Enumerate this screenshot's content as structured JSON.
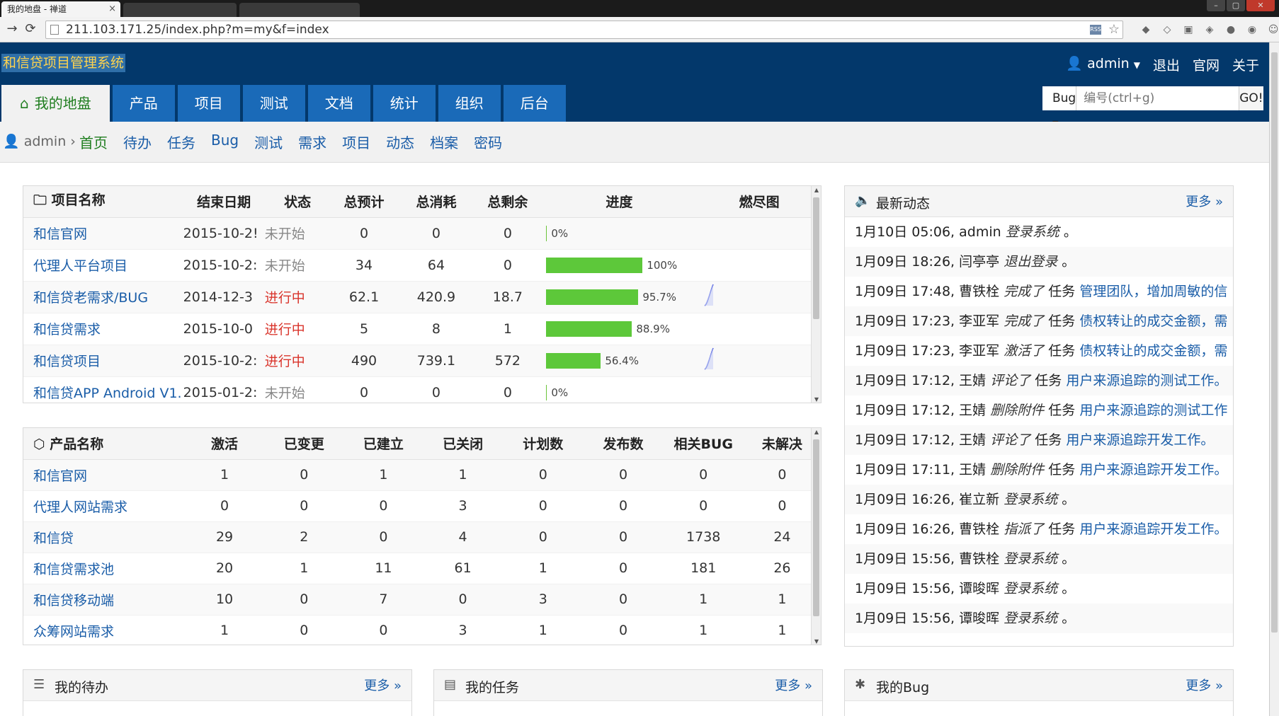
{
  "browser": {
    "tab_title": "我的地盘 - 禅道",
    "tab_close": "×",
    "url": "211.103.171.25/index.php?m=my&f=index",
    "win_controls": [
      "–",
      "▢",
      "✕"
    ]
  },
  "header": {
    "app_title": "和信贷项目管理系统",
    "user": "admin",
    "links": [
      "退出",
      "官网",
      "关于"
    ],
    "nav": [
      "我的地盘",
      "产品",
      "项目",
      "测试",
      "文档",
      "统计",
      "组织",
      "后台"
    ],
    "search": {
      "type": "Bug",
      "placeholder": "编号(ctrl+g)",
      "go": "GO!"
    }
  },
  "subnav": {
    "user": "admin",
    "items": [
      "首页",
      "待办",
      "任务",
      "Bug",
      "测试",
      "需求",
      "项目",
      "动态",
      "档案",
      "密码"
    ]
  },
  "projects": {
    "headers": [
      "项目名称",
      "结束日期",
      "状态",
      "总预计",
      "总消耗",
      "总剩余",
      "进度",
      "燃尽图"
    ],
    "rows": [
      {
        "name": "和信官网",
        "end": "2015-10-2!",
        "status": "未开始",
        "est": "0",
        "cons": "0",
        "left": "0",
        "pct": "0%",
        "progress": 0,
        "burn": false
      },
      {
        "name": "代理人平台项目",
        "end": "2015-10-2:",
        "status": "未开始",
        "est": "34",
        "cons": "64",
        "left": "0",
        "pct": "100%",
        "progress": 100,
        "burn": false
      },
      {
        "name": "和信贷老需求/BUG",
        "end": "2014-12-3",
        "status": "进行中",
        "est": "62.1",
        "cons": "420.9",
        "left": "18.7",
        "pct": "95.7%",
        "progress": 95.7,
        "burn": true
      },
      {
        "name": "和信贷需求",
        "end": "2015-10-0",
        "status": "进行中",
        "est": "5",
        "cons": "8",
        "left": "1",
        "pct": "88.9%",
        "progress": 88.9,
        "burn": false
      },
      {
        "name": "和信贷项目",
        "end": "2015-10-2:",
        "status": "进行中",
        "est": "490",
        "cons": "739.1",
        "left": "572",
        "pct": "56.4%",
        "progress": 56.4,
        "burn": true
      },
      {
        "name": "和信贷APP Android V1.",
        "end": "2015-01-2:",
        "status": "未开始",
        "est": "0",
        "cons": "0",
        "left": "0",
        "pct": "0%",
        "progress": 0,
        "burn": false
      }
    ]
  },
  "products": {
    "headers": [
      "产品名称",
      "激活",
      "已变更",
      "已建立",
      "已关闭",
      "计划数",
      "发布数",
      "相关BUG",
      "未解决"
    ],
    "rows": [
      [
        "和信官网",
        "1",
        "0",
        "1",
        "1",
        "0",
        "0",
        "0",
        "0"
      ],
      [
        "代理人网站需求",
        "0",
        "0",
        "0",
        "3",
        "0",
        "0",
        "0",
        "0"
      ],
      [
        "和信贷",
        "29",
        "2",
        "0",
        "4",
        "0",
        "0",
        "1738",
        "24"
      ],
      [
        "和信贷需求池",
        "20",
        "1",
        "11",
        "61",
        "1",
        "0",
        "181",
        "26"
      ],
      [
        "和信贷移动端",
        "10",
        "0",
        "7",
        "0",
        "3",
        "0",
        "1",
        "1"
      ],
      [
        "众筹网站需求",
        "1",
        "0",
        "0",
        "3",
        "1",
        "0",
        "1",
        "1"
      ]
    ]
  },
  "dynamics": {
    "title": "最新动态",
    "more": "更多 »",
    "rows": [
      {
        "time": "1月10日 05:06,",
        "user": "admin",
        "action": "登录系统",
        "object": "",
        "target": "",
        "tail": "。"
      },
      {
        "time": "1月09日 18:26,",
        "user": "闫亭亭",
        "action": "退出登录",
        "object": "",
        "target": "",
        "tail": "。"
      },
      {
        "time": "1月09日 17:48,",
        "user": "曹铁栓",
        "action": "完成了",
        "object": "任务",
        "target": "管理团队，增加周敏的信",
        "tail": ""
      },
      {
        "time": "1月09日 17:23,",
        "user": "李亚军",
        "action": "完成了",
        "object": "任务",
        "target": "债权转让的成交金额，需",
        "tail": ""
      },
      {
        "time": "1月09日 17:23,",
        "user": "李亚军",
        "action": "激活了",
        "object": "任务",
        "target": "债权转让的成交金额，需",
        "tail": ""
      },
      {
        "time": "1月09日 17:12,",
        "user": "王婧",
        "action": "评论了",
        "object": "任务",
        "target": "用户来源追踪的测试工作。",
        "tail": ""
      },
      {
        "time": "1月09日 17:12,",
        "user": "王婧",
        "action": "删除附件",
        "object": "任务",
        "target": "用户来源追踪的测试工作",
        "tail": ""
      },
      {
        "time": "1月09日 17:12,",
        "user": "王婧",
        "action": "评论了",
        "object": "任务",
        "target": "用户来源追踪开发工作。",
        "tail": ""
      },
      {
        "time": "1月09日 17:11,",
        "user": "王婧",
        "action": "删除附件",
        "object": "任务",
        "target": "用户来源追踪开发工作。",
        "tail": ""
      },
      {
        "time": "1月09日 16:26,",
        "user": "崔立新",
        "action": "登录系统",
        "object": "",
        "target": "",
        "tail": "。"
      },
      {
        "time": "1月09日 16:26,",
        "user": "曹铁栓",
        "action": "指派了",
        "object": "任务",
        "target": "用户来源追踪开发工作。",
        "tail": ""
      },
      {
        "time": "1月09日 15:56,",
        "user": "曹铁栓",
        "action": "登录系统",
        "object": "",
        "target": "",
        "tail": "。"
      },
      {
        "time": "1月09日 15:56,",
        "user": "谭晙晖",
        "action": "登录系统",
        "object": "",
        "target": "",
        "tail": "。"
      },
      {
        "time": "1月09日 15:56,",
        "user": "谭晙晖",
        "action": "登录系统",
        "object": "",
        "target": "",
        "tail": "。"
      }
    ]
  },
  "bottom_panels": [
    {
      "title": "我的待办",
      "more": "更多 »"
    },
    {
      "title": "我的任务",
      "more": "更多 »"
    },
    {
      "title": "我的Bug",
      "more": "更多 »"
    }
  ]
}
